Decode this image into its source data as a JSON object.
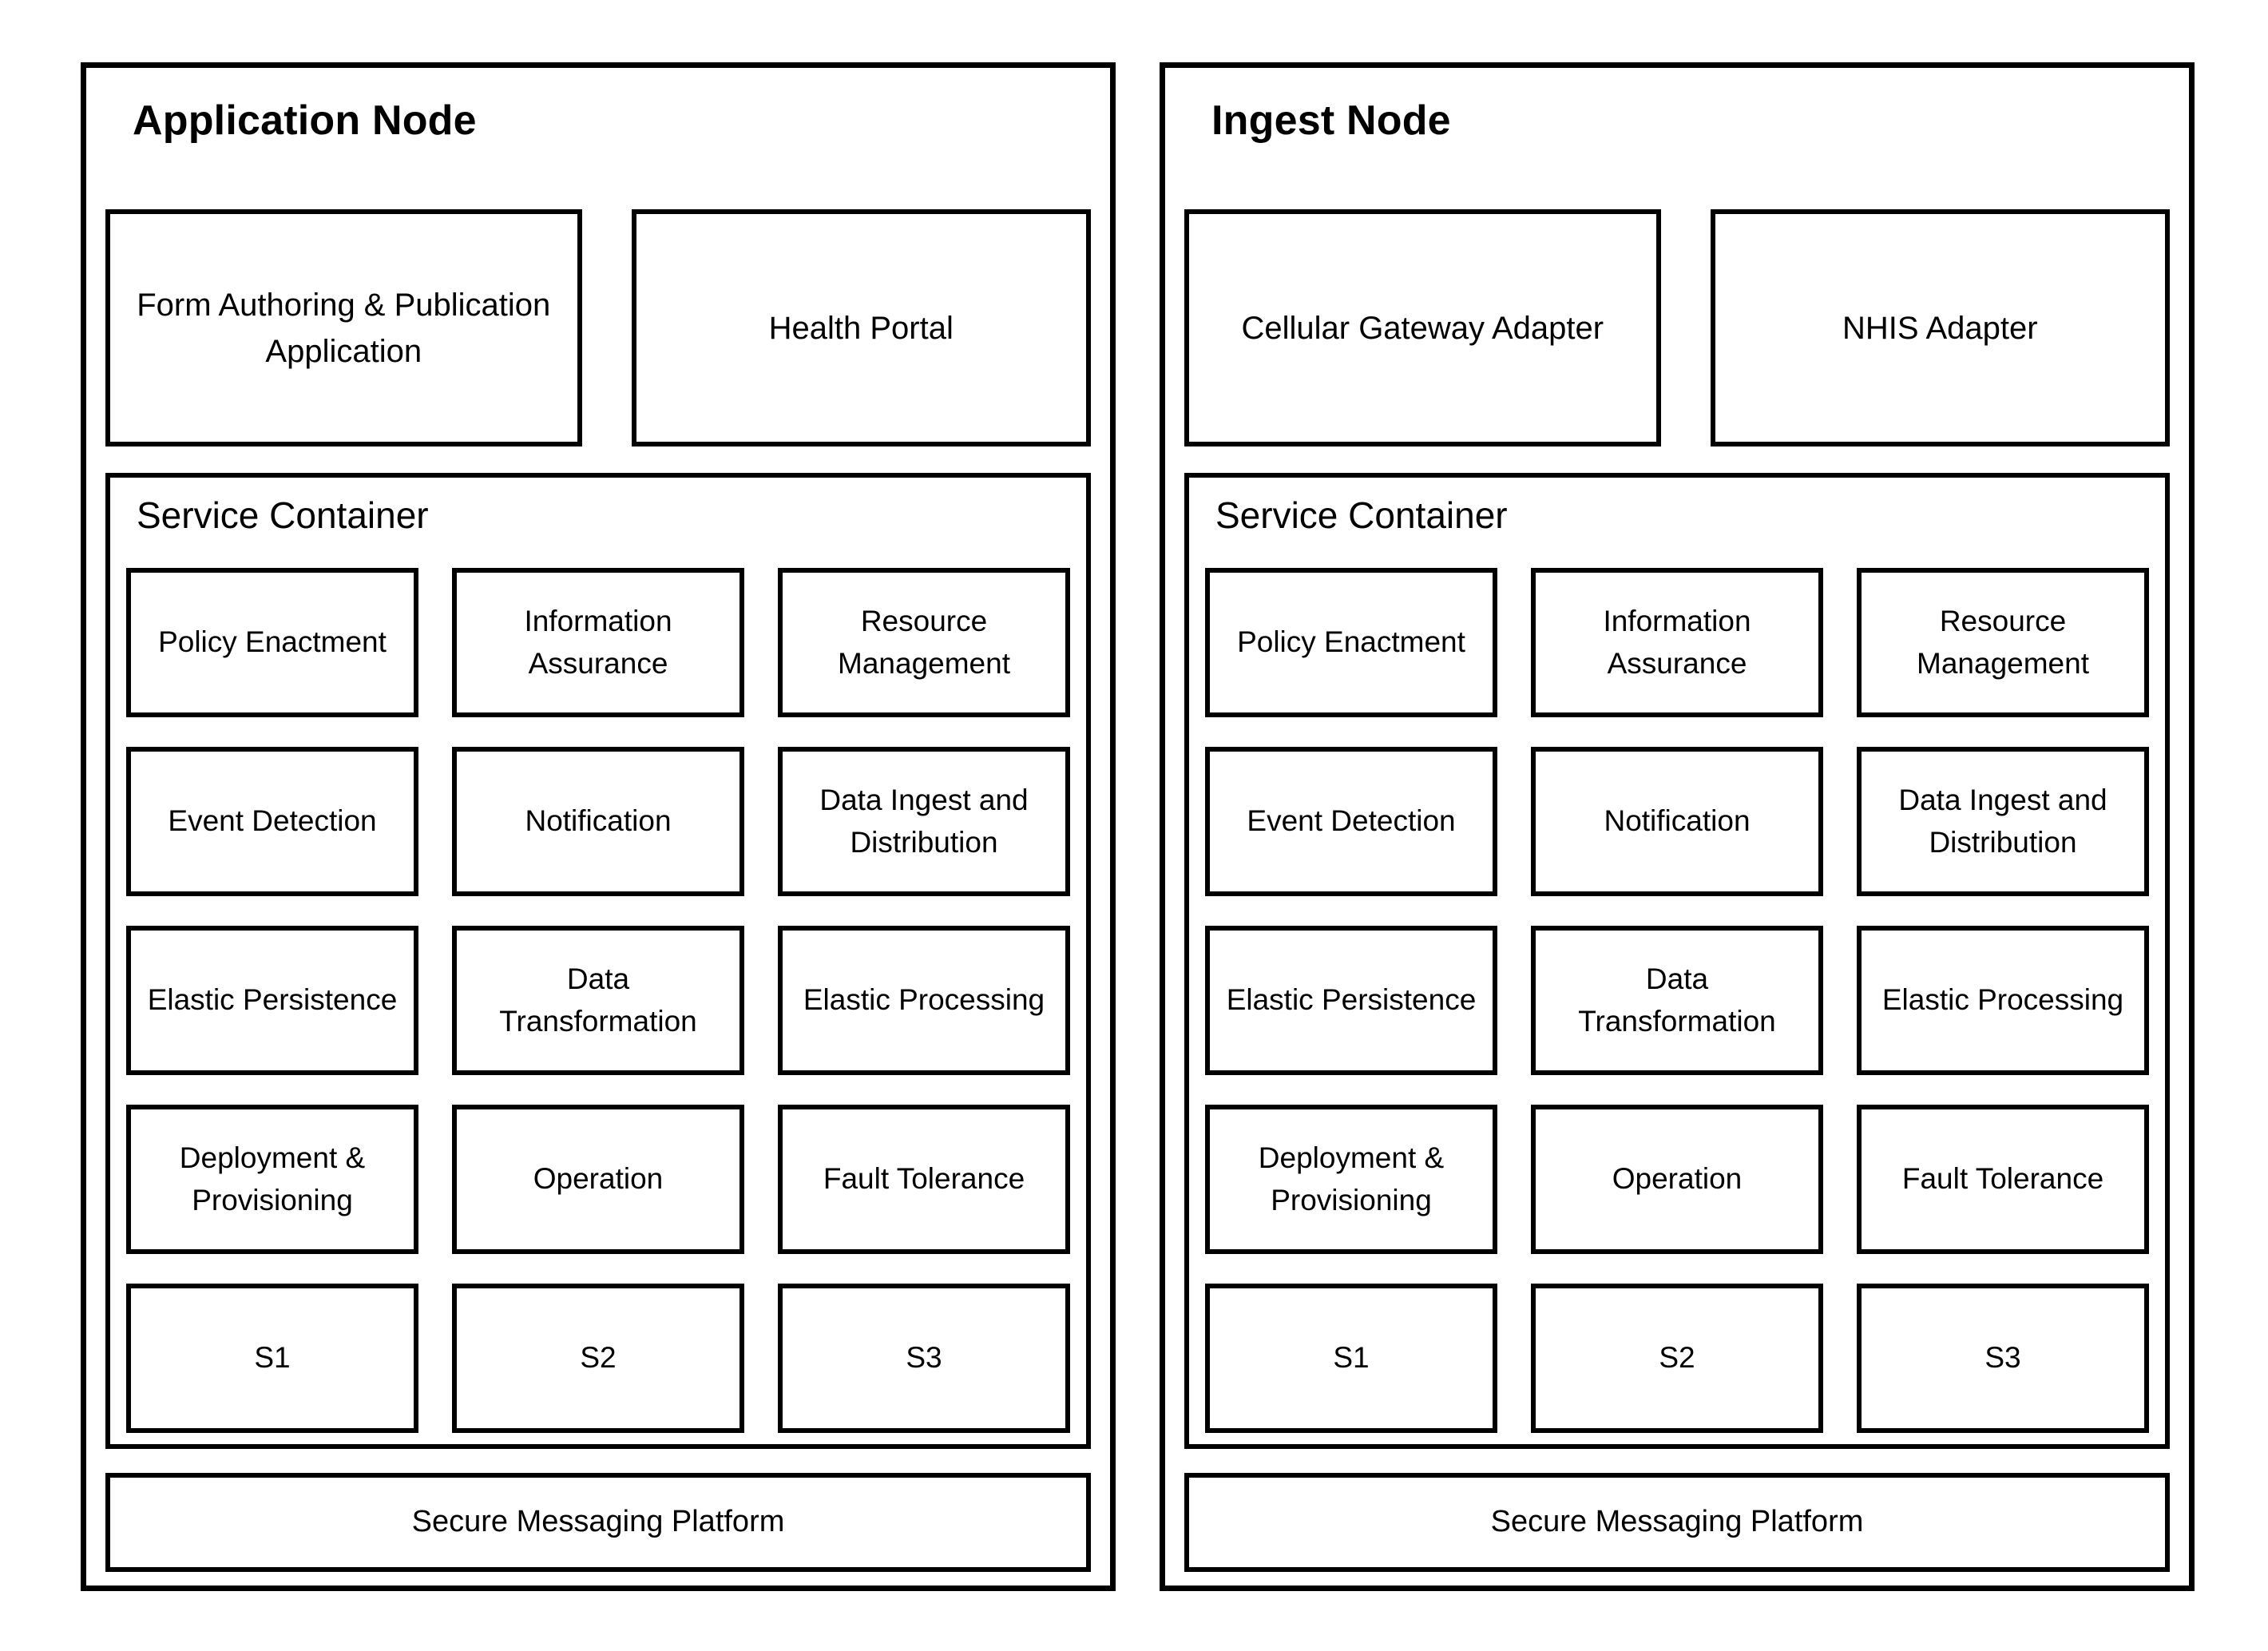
{
  "diagram": {
    "type": "block-architecture",
    "panel_count": 2,
    "stroke_color": "#000000",
    "background_color": "#ffffff"
  },
  "nodes": [
    {
      "id": "application-node",
      "title": "Application Node",
      "applications": [
        {
          "label": "Form Authoring & Publication Application"
        },
        {
          "label": "Health Portal"
        }
      ],
      "service_container": {
        "title": "Service Container",
        "services": [
          {
            "label": "Policy Enactment"
          },
          {
            "label": "Information Assurance"
          },
          {
            "label": "Resource Management"
          },
          {
            "label": "Event Detection"
          },
          {
            "label": "Notification"
          },
          {
            "label": "Data Ingest and Distribution"
          },
          {
            "label": "Elastic Persistence"
          },
          {
            "label": "Data Transformation"
          },
          {
            "label": "Elastic Processing"
          },
          {
            "label": "Deployment & Provisioning"
          },
          {
            "label": "Operation"
          },
          {
            "label": "Fault Tolerance"
          },
          {
            "label": "S1"
          },
          {
            "label": "S2"
          },
          {
            "label": "S3"
          }
        ]
      },
      "messaging_platform": "Secure Messaging Platform"
    },
    {
      "id": "ingest-node",
      "title": "Ingest Node",
      "applications": [
        {
          "label": "Cellular Gateway Adapter"
        },
        {
          "label": "NHIS Adapter"
        }
      ],
      "service_container": {
        "title": "Service Container",
        "services": [
          {
            "label": "Policy Enactment"
          },
          {
            "label": "Information Assurance"
          },
          {
            "label": "Resource Management"
          },
          {
            "label": "Event Detection"
          },
          {
            "label": "Notification"
          },
          {
            "label": "Data Ingest and Distribution"
          },
          {
            "label": "Elastic Persistence"
          },
          {
            "label": "Data Transformation"
          },
          {
            "label": "Elastic Processing"
          },
          {
            "label": "Deployment & Provisioning"
          },
          {
            "label": "Operation"
          },
          {
            "label": "Fault Tolerance"
          },
          {
            "label": "S1"
          },
          {
            "label": "S2"
          },
          {
            "label": "S3"
          }
        ]
      },
      "messaging_platform": "Secure Messaging Platform"
    }
  ]
}
